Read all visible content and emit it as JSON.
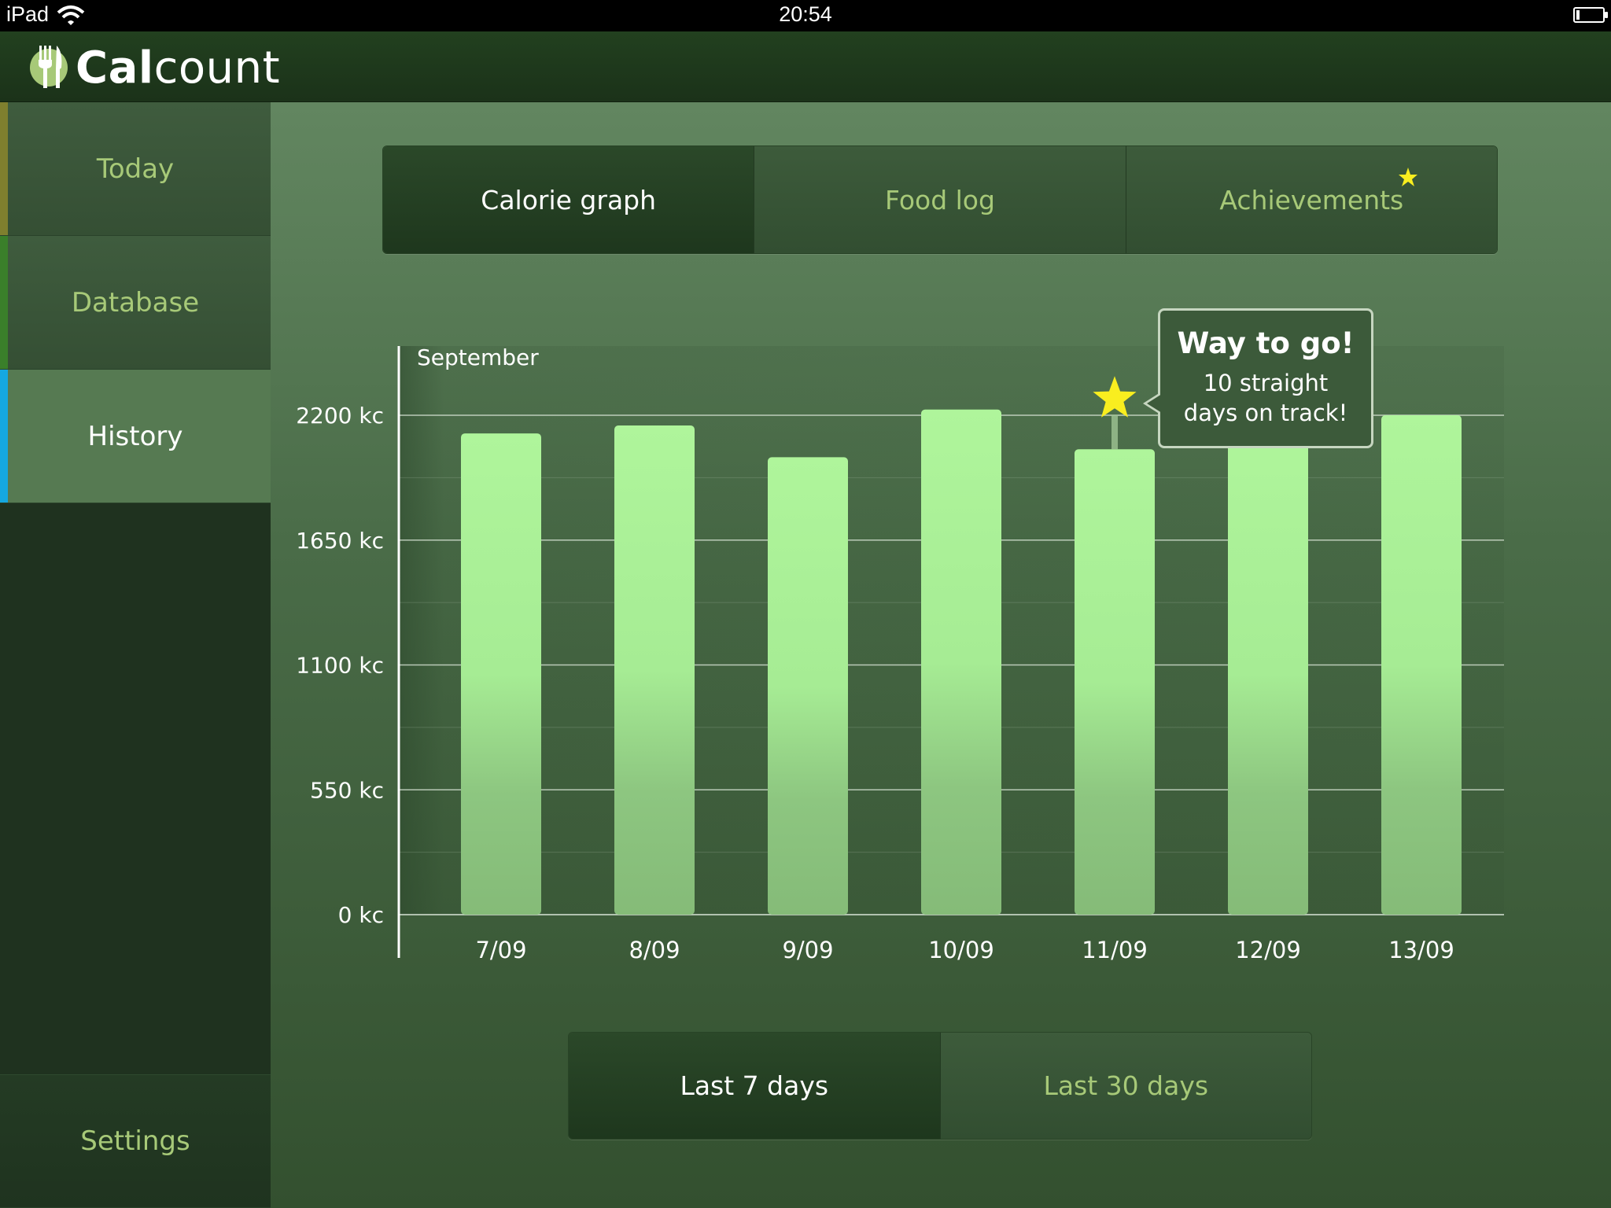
{
  "status_bar": {
    "device": "iPad",
    "time": "20:54"
  },
  "header": {
    "logo_bold": "Cal",
    "logo_regular": "count"
  },
  "sidebar": {
    "items": [
      {
        "label": "Today",
        "accent": "#7f7f2e"
      },
      {
        "label": "Database",
        "accent": "#3a7f2a"
      },
      {
        "label": "History",
        "accent": "#15a8e0"
      }
    ],
    "settings_label": "Settings"
  },
  "tabs": [
    {
      "label": "Calorie graph"
    },
    {
      "label": "Food log"
    },
    {
      "label": "Achievements"
    }
  ],
  "range": [
    {
      "label": "Last 7 days"
    },
    {
      "label": "Last 30 days"
    }
  ],
  "tooltip": {
    "title": "Way to go!",
    "line1": "10 straight",
    "line2": "days on track!"
  },
  "colors": {
    "bar": "#aff59b",
    "star": "#f9ee1f",
    "accent_text": "#a7c978"
  },
  "chart_data": {
    "type": "bar",
    "month_label": "September",
    "categories": [
      "7/09",
      "8/09",
      "9/09",
      "10/09",
      "11/09",
      "12/09",
      "13/09"
    ],
    "values": [
      2120,
      2155,
      2015,
      2225,
      2050,
      2120,
      2200
    ],
    "ylim": [
      0,
      2200
    ],
    "yticks": [
      {
        "value": 0,
        "label": "0 kc"
      },
      {
        "value": 550,
        "label": "550 kc"
      },
      {
        "value": 1100,
        "label": "1100 kc"
      },
      {
        "value": 1650,
        "label": "1650 kc"
      },
      {
        "value": 2200,
        "label": "2200 kc"
      }
    ],
    "highlight_category": "11/09",
    "grid": true
  }
}
